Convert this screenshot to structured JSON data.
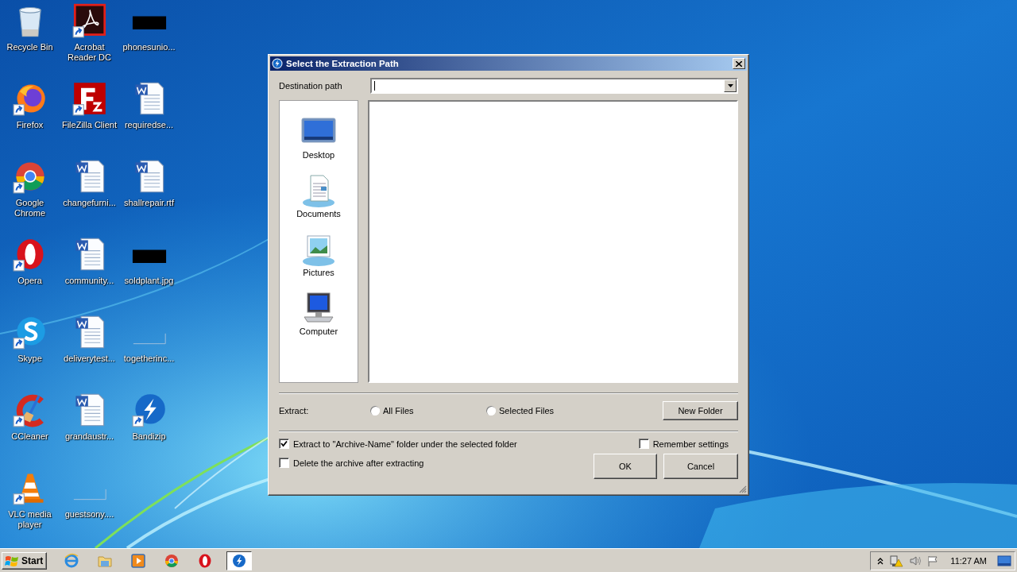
{
  "desktop_icons": [
    {
      "kind": "recycle",
      "label": "Recycle Bin",
      "shortcut": false
    },
    {
      "kind": "firefox",
      "label": "Firefox",
      "shortcut": true
    },
    {
      "kind": "chrome",
      "label": "Google Chrome",
      "shortcut": true
    },
    {
      "kind": "opera",
      "label": "Opera",
      "shortcut": true
    },
    {
      "kind": "skype",
      "label": "Skype",
      "shortcut": true
    },
    {
      "kind": "ccleaner",
      "label": "CCleaner",
      "shortcut": true
    },
    {
      "kind": "vlc",
      "label": "VLC media player",
      "shortcut": true
    },
    {
      "kind": "acrobat",
      "label": "Acrobat Reader DC",
      "shortcut": true
    },
    {
      "kind": "filezilla",
      "label": "FileZilla Client",
      "shortcut": true
    },
    {
      "kind": "word",
      "label": "changefurni...",
      "shortcut": false
    },
    {
      "kind": "word",
      "label": "community...",
      "shortcut": false
    },
    {
      "kind": "word",
      "label": "deliverytest...",
      "shortcut": false
    },
    {
      "kind": "word",
      "label": "grandaustr...",
      "shortcut": false
    },
    {
      "kind": "blank",
      "label": "guestsony....",
      "shortcut": false
    },
    {
      "kind": "black",
      "label": "phonesunio...",
      "shortcut": false
    },
    {
      "kind": "word",
      "label": "requiredse...",
      "shortcut": false
    },
    {
      "kind": "word",
      "label": "shallrepair.rtf",
      "shortcut": false
    },
    {
      "kind": "black",
      "label": "soldplant.jpg",
      "shortcut": false
    },
    {
      "kind": "blank",
      "label": "togetherinc...",
      "shortcut": false
    },
    {
      "kind": "bandizip",
      "label": "Bandizip",
      "shortcut": true
    }
  ],
  "dialog": {
    "title": "Select the Extraction Path",
    "destination_label": "Destination path",
    "places": [
      {
        "kind": "desktop",
        "label": "Desktop"
      },
      {
        "kind": "documents",
        "label": "Documents"
      },
      {
        "kind": "pictures",
        "label": "Pictures"
      },
      {
        "kind": "computer",
        "label": "Computer"
      }
    ],
    "extract_label": "Extract:",
    "extract_options": [
      {
        "label": "All Files",
        "selected": false
      },
      {
        "label": "Selected Files",
        "selected": false
      }
    ],
    "new_folder_button": "New Folder",
    "options": [
      {
        "label": "Extract to \"Archive-Name\" folder under the selected folder",
        "checked": true
      },
      {
        "label": "Delete the archive after extracting",
        "checked": false
      }
    ],
    "remember": {
      "label": "Remember settings",
      "checked": false
    },
    "buttons": [
      "OK",
      "Cancel"
    ]
  },
  "taskbar": {
    "start": "Start",
    "apps": [
      {
        "kind": "ie",
        "active": false
      },
      {
        "kind": "folder",
        "active": false
      },
      {
        "kind": "media",
        "active": false
      },
      {
        "kind": "chrome",
        "active": false
      },
      {
        "kind": "opera",
        "active": false
      },
      {
        "kind": "bandizip",
        "active": true
      }
    ],
    "clock": "11:27 AM"
  }
}
